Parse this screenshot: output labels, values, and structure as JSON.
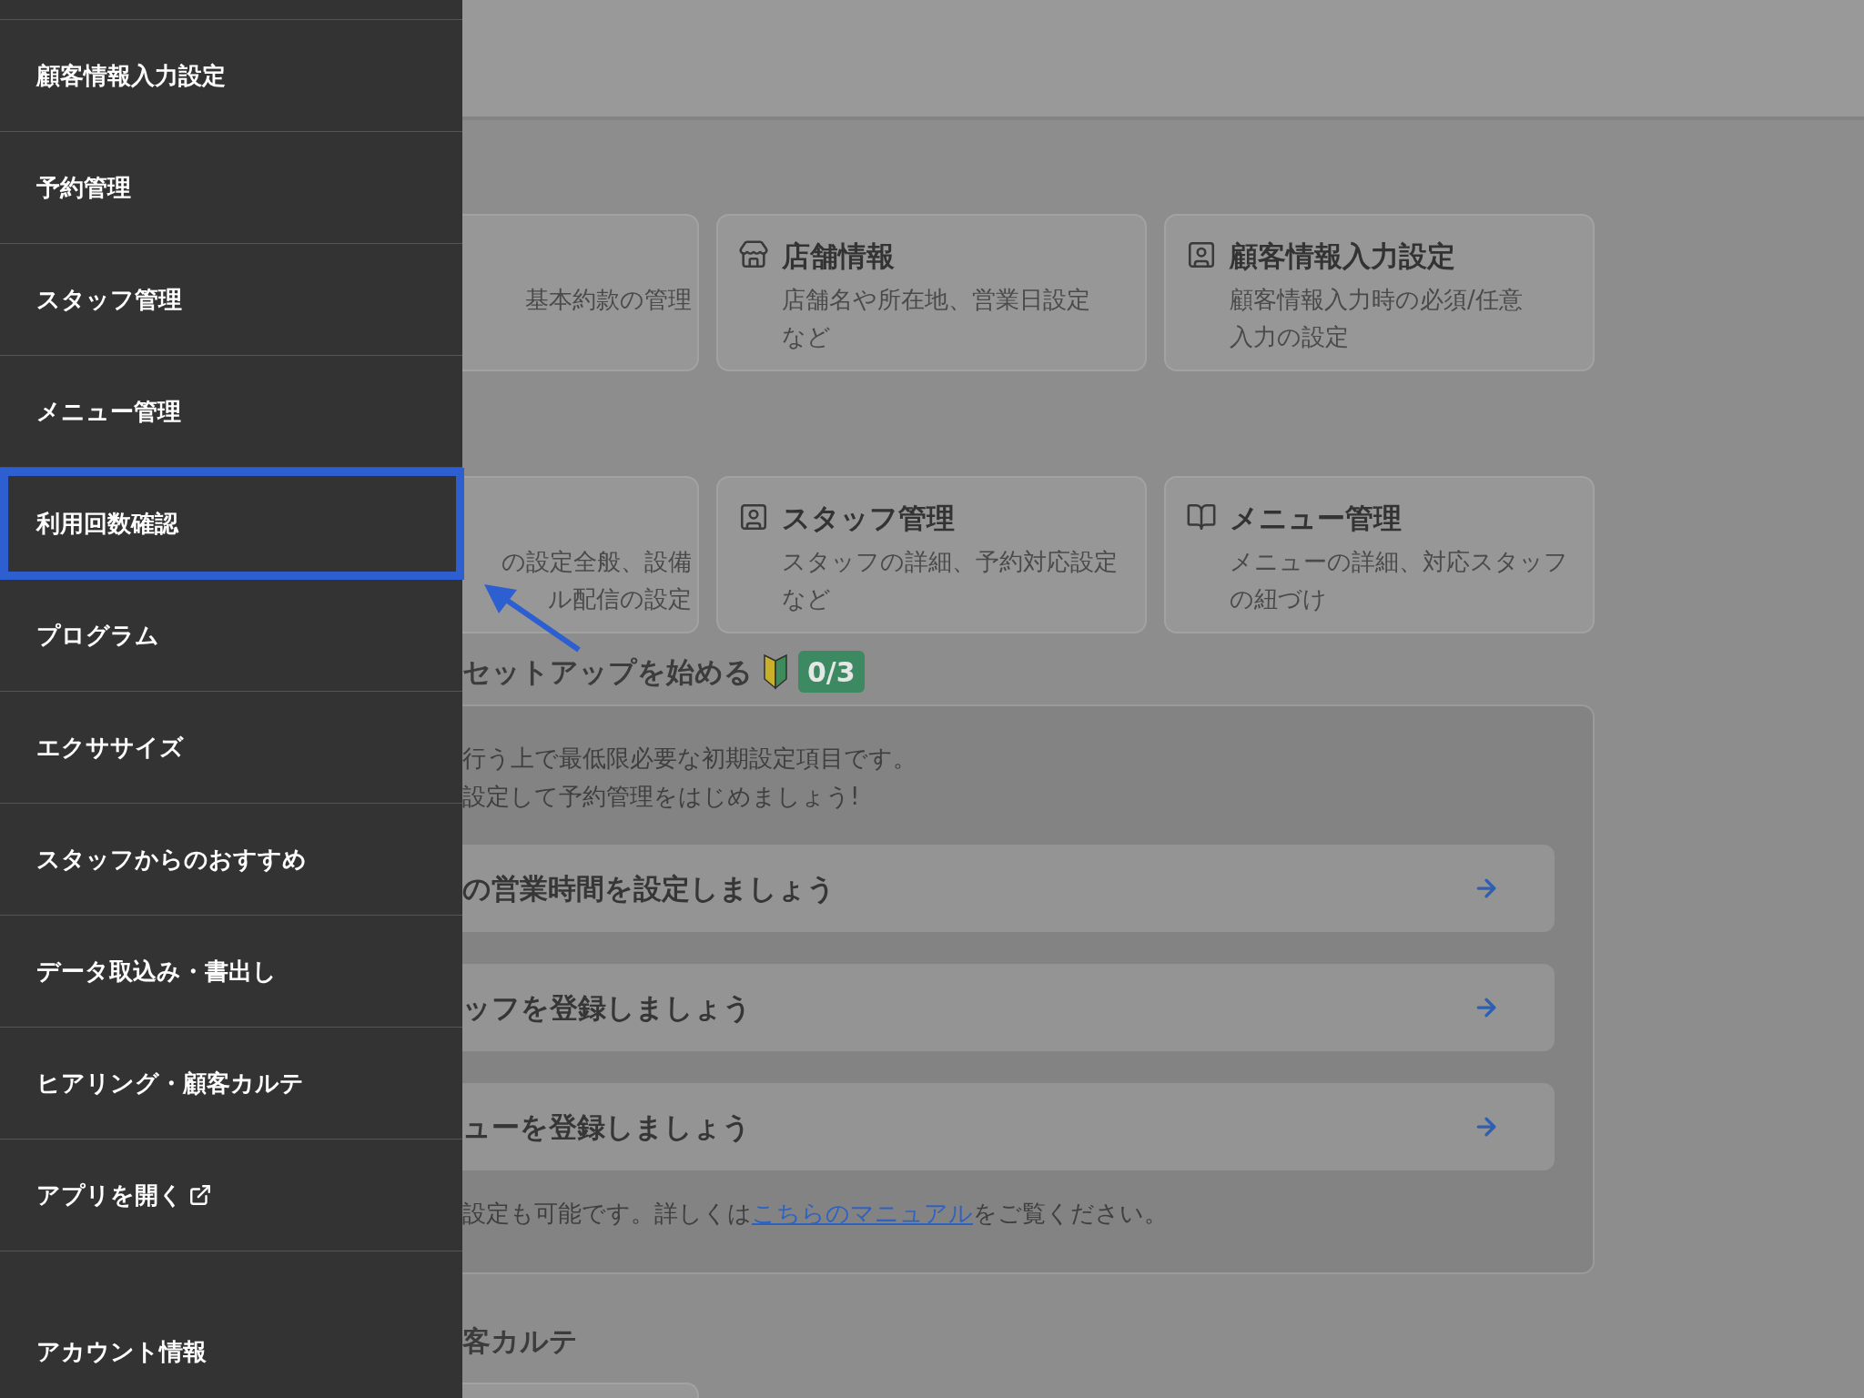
{
  "sidebar": {
    "items": [
      {
        "label": "顧客情報入力設定",
        "selected": false,
        "external": false
      },
      {
        "label": "予約管理",
        "selected": false,
        "external": false
      },
      {
        "label": "スタッフ管理",
        "selected": false,
        "external": false
      },
      {
        "label": "メニュー管理",
        "selected": false,
        "external": false
      },
      {
        "label": "利用回数確認",
        "selected": true,
        "external": false
      },
      {
        "label": "プログラム",
        "selected": false,
        "external": false
      },
      {
        "label": "エクササイズ",
        "selected": false,
        "external": false
      },
      {
        "label": "スタッフからのおすすめ",
        "selected": false,
        "external": false
      },
      {
        "label": "データ取込み・書出し",
        "selected": false,
        "external": false
      },
      {
        "label": "ヒアリング・顧客カルテ",
        "selected": false,
        "external": false
      },
      {
        "label": "アプリを開く",
        "selected": false,
        "external": true
      },
      {
        "label": "アカウント情報",
        "selected": false,
        "external": false
      }
    ]
  },
  "cards": [
    {
      "kind": "partial",
      "description": [
        "基本約款の管理"
      ]
    },
    {
      "kind": "store",
      "title": "店舗情報",
      "description": [
        "店舗名や所在地、営業日設定",
        "など"
      ]
    },
    {
      "kind": "person",
      "title": "顧客情報入力設定",
      "description": [
        "顧客情報入力時の必須/任意",
        "入力の設定"
      ]
    },
    {
      "kind": "partial",
      "description": [
        "の設定全般、設備",
        "ル配信の設定"
      ]
    },
    {
      "kind": "person",
      "title": "スタッフ管理",
      "description": [
        "スタッフの詳細、予約対応設定",
        "など"
      ]
    },
    {
      "kind": "book",
      "title": "メニュー管理",
      "description": [
        "メニューの詳細、対応スタッフ",
        "の紐づけ"
      ]
    }
  ],
  "setup": {
    "heading": "セットアップを始める",
    "progress": "0/3",
    "intro": [
      "行う上で最低限必要な初期設定項目です。",
      "設定して予約管理をはじめましょう!"
    ],
    "tasks": [
      {
        "label": "の営業時間を設定しましょう"
      },
      {
        "label": "ッフを登録しましょう"
      },
      {
        "label": "ューを登録しましょう"
      }
    ],
    "footer": {
      "before": "設定も可能です。詳しくは",
      "link": "こちらのマニュアル",
      "after": "をご覧ください。"
    }
  },
  "next_section": {
    "heading": "客カルテ"
  }
}
